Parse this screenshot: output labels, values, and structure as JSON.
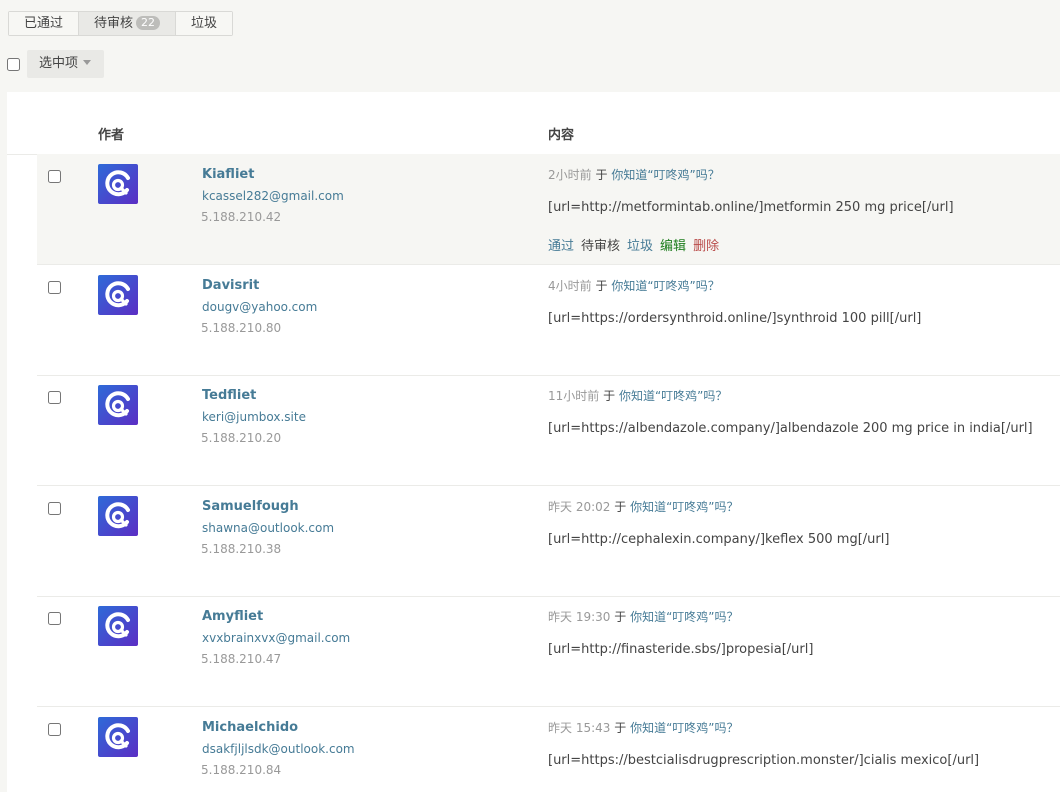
{
  "tabs": [
    {
      "label": "已通过"
    },
    {
      "label": "待审核",
      "badge": "22"
    },
    {
      "label": "垃圾"
    }
  ],
  "bulk": {
    "label": "选中项"
  },
  "table": {
    "col_author": "作者",
    "col_content": "内容"
  },
  "on_word": "于",
  "actions": {
    "approve": "通过",
    "pending": "待审核",
    "spam": "垃圾",
    "edit": "编辑",
    "delete": "删除"
  },
  "colors": {
    "link": "#467b96",
    "edit": "#1d7d1d",
    "delete": "#b94a48",
    "avatar_gradient": [
      "#2e6ad8",
      "#5b2ec4"
    ]
  },
  "comments": [
    {
      "author": "Kiafliet",
      "email": "kcassel282@gmail.com",
      "ip": "5.188.210.42",
      "time": "2小时前",
      "post": "你知道“叮咚鸡”吗？",
      "content": "[url=http://metformintab.online/]metformin 250 mg price[/url]"
    },
    {
      "author": "Davisrit",
      "email": "dougv@yahoo.com",
      "ip": "5.188.210.80",
      "time": "4小时前",
      "post": "你知道“叮咚鸡”吗？",
      "content": "[url=https://ordersynthroid.online/]synthroid 100 pill[/url]"
    },
    {
      "author": "Tedfliet",
      "email": "keri@jumbox.site",
      "ip": "5.188.210.20",
      "time": "11小时前",
      "post": "你知道“叮咚鸡”吗？",
      "content": "[url=https://albendazole.company/]albendazole 200 mg price in india[/url]"
    },
    {
      "author": "Samuelfough",
      "email": "shawna@outlook.com",
      "ip": "5.188.210.38",
      "time": "昨天 20:02",
      "post": "你知道“叮咚鸡”吗？",
      "content": "[url=http://cephalexin.company/]keflex 500 mg[/url]"
    },
    {
      "author": "Amyfliet",
      "email": "xvxbrainxvx@gmail.com",
      "ip": "5.188.210.47",
      "time": "昨天 19:30",
      "post": "你知道“叮咚鸡”吗？",
      "content": "[url=http://finasteride.sbs/]propesia[/url]"
    },
    {
      "author": "Michaelchido",
      "email": "dsakfjljlsdk@outlook.com",
      "ip": "5.188.210.84",
      "time": "昨天 15:43",
      "post": "你知道“叮咚鸡”吗？",
      "content": "[url=https://bestcialisdrugprescription.monster/]cialis mexico[/url]"
    }
  ]
}
